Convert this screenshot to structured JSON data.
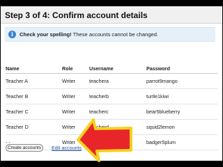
{
  "header": {
    "title": "Step 3 of 4: Confirm account details"
  },
  "notice": {
    "icon": "info-icon",
    "strong": "Check your spelling!",
    "text": " These accounts cannot be changed."
  },
  "table": {
    "columns": [
      "Name",
      "Role",
      "Username",
      "Password"
    ],
    "rows": [
      [
        "Teacher A",
        "Writer",
        "teachera",
        "parrot9mango"
      ],
      [
        "Teacher B",
        "Writer",
        "teacherb",
        "turtle1kiwi"
      ],
      [
        "Teacher C",
        "Writer",
        "teacherc",
        "bear5blueberry"
      ],
      [
        "Teacher D",
        "Writer",
        "teacherd",
        "squid2lemon"
      ],
      [
        "- -",
        "Writer",
        "wikiuser0005",
        "badger5plum"
      ]
    ]
  },
  "actions": {
    "create_label": "Create accounts",
    "edit_label": "Edit accounts"
  },
  "colors": {
    "arrow_fill": "#e8262a",
    "arrow_stroke": "#f4d21f",
    "notice_bg": "#e6f0f9",
    "link": "#2a4f9c"
  }
}
